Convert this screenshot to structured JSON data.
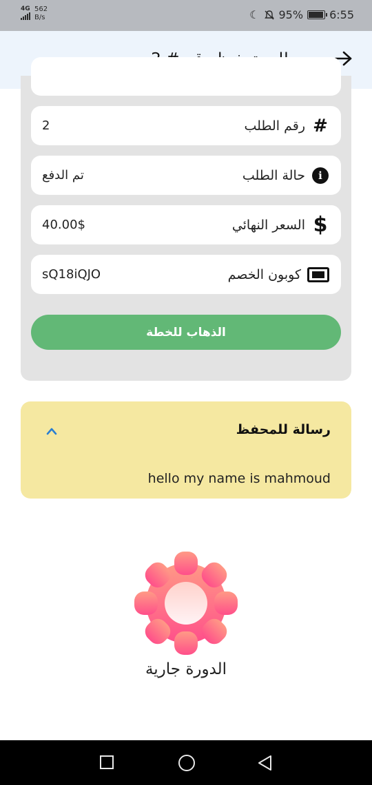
{
  "status_bar": {
    "network": "4G",
    "net_speed_value": "562",
    "net_speed_unit": "B/s",
    "battery_percent": "95%",
    "battery_level": 0.95,
    "time": "6:55"
  },
  "appbar": {
    "title": "طلب تحفيظ رقم # 2",
    "back_icon": "arrow-right-icon"
  },
  "order": {
    "fields": [
      {
        "label": "رقم الطلب",
        "value": "2",
        "icon": "hash-icon"
      },
      {
        "label": "حالة الطلب",
        "value": "تم الدفع",
        "icon": "info-icon"
      },
      {
        "label": "السعر النهائي",
        "value": "40.00$",
        "icon": "dollar-icon"
      },
      {
        "label": "كوبون الخصم",
        "value": "sQ18iQJO",
        "icon": "ticket-icon"
      }
    ],
    "go_button": "الذهاب للخطة"
  },
  "message": {
    "title": "رسالة للمحفظ",
    "body": "hello my name is mahmoud",
    "toggle_icon": "chevron-up-icon"
  },
  "course_status": {
    "caption": "الدورة جارية",
    "icon": "gear-icon"
  },
  "colors": {
    "appbar_bg": "#edf4fc",
    "card_bg": "#e3e3e3",
    "button_green": "#62b876",
    "message_bg": "#f5e8a1",
    "gear_top": "#ff9a86",
    "gear_bottom": "#ff4f8a",
    "chevron_blue": "#2a7fd1"
  }
}
